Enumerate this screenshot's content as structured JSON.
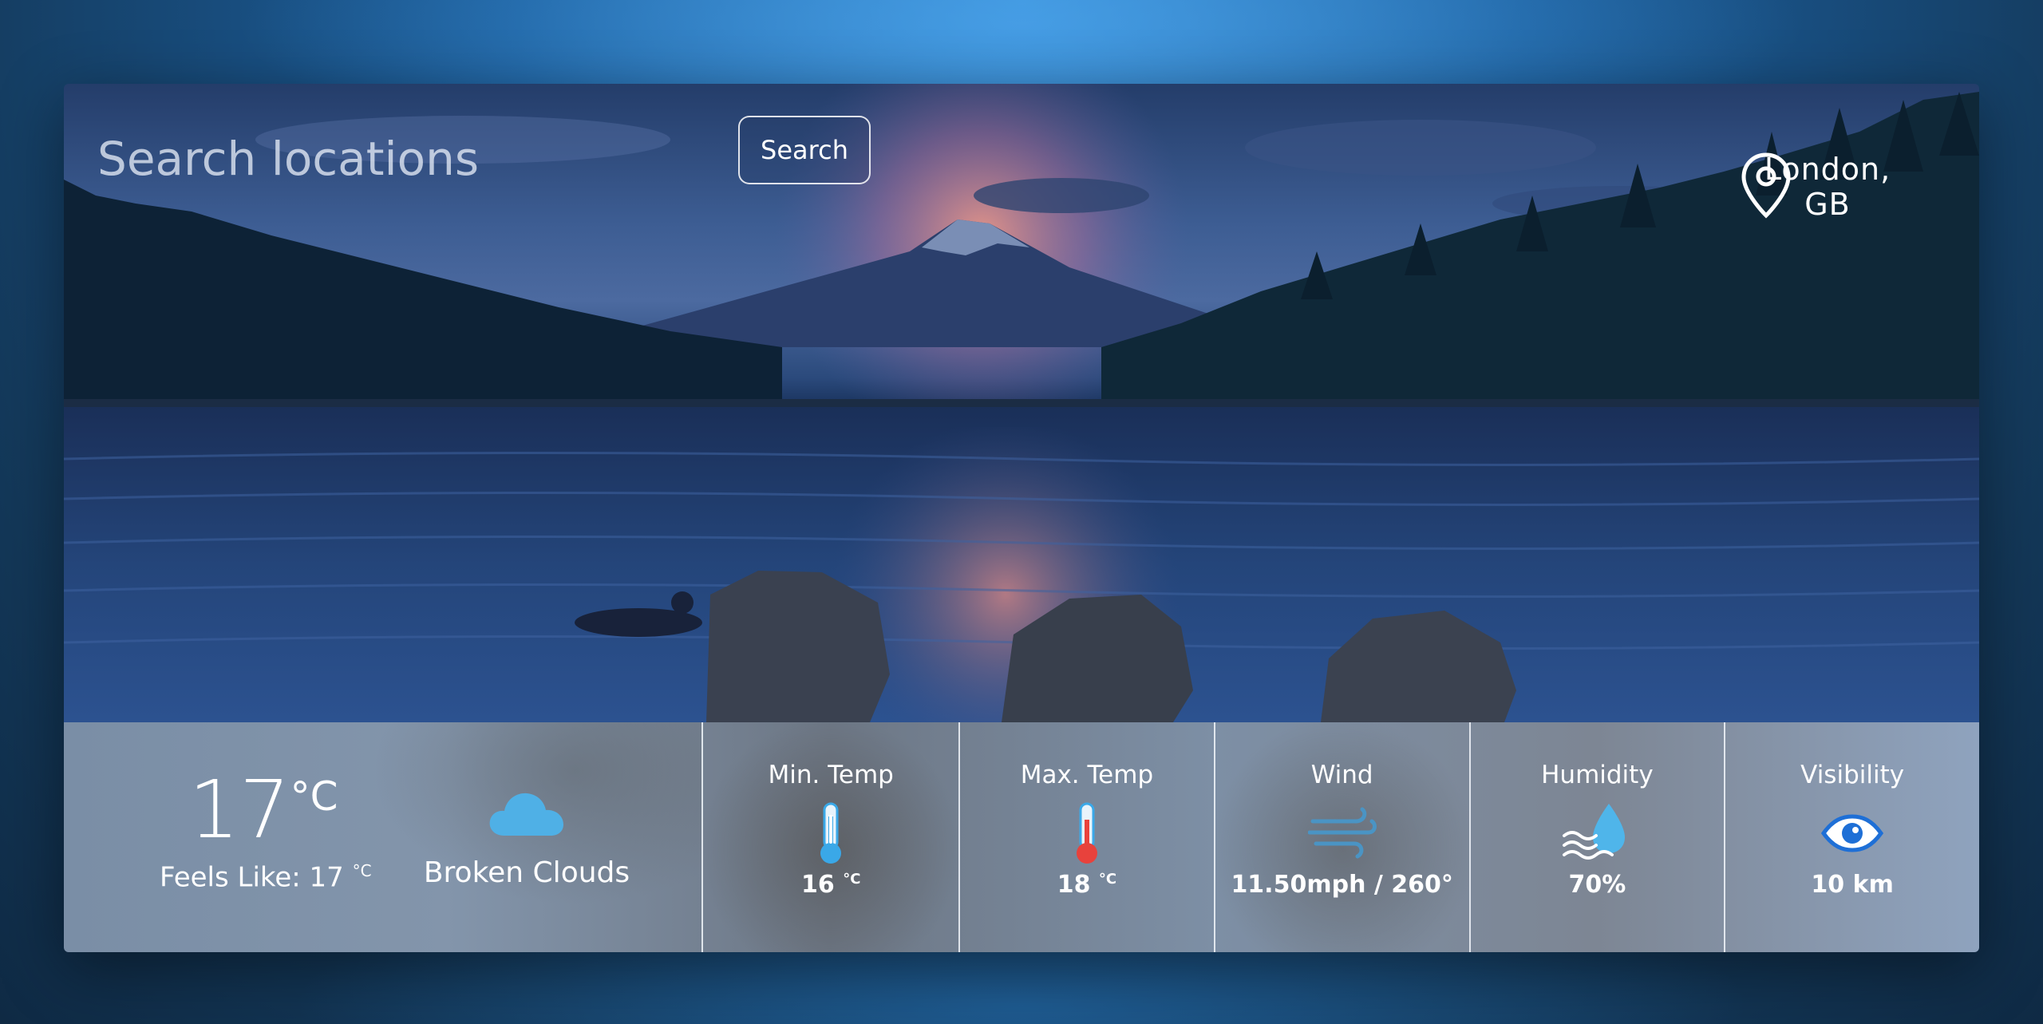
{
  "search": {
    "placeholder": "Search locations",
    "button_label": "Search"
  },
  "location": {
    "name": "London, GB",
    "icon": "map-pin-icon"
  },
  "current": {
    "temperature": "17",
    "unit": "°C",
    "feels_like_label": "Feels Like: 17",
    "feels_like_unit": "°C",
    "condition": "Broken Clouds",
    "condition_icon": "cloud-icon"
  },
  "stats": [
    {
      "label": "Min. Temp",
      "value": "16",
      "unit": "°C",
      "icon": "thermometer-cold-icon"
    },
    {
      "label": "Max. Temp",
      "value": "18",
      "unit": "°C",
      "icon": "thermometer-hot-icon"
    },
    {
      "label": "Wind",
      "value": "11.50mph / 260°",
      "unit": "",
      "icon": "wind-icon"
    },
    {
      "label": "Humidity",
      "value": "70%",
      "unit": "",
      "icon": "humidity-icon"
    },
    {
      "label": "Visibility",
      "value": "10 km",
      "unit": "",
      "icon": "eye-icon"
    }
  ],
  "colors": {
    "accent_blue": "#3aa8e8",
    "hot_red": "#e8423c",
    "eye_blue": "#1e6fd6"
  }
}
